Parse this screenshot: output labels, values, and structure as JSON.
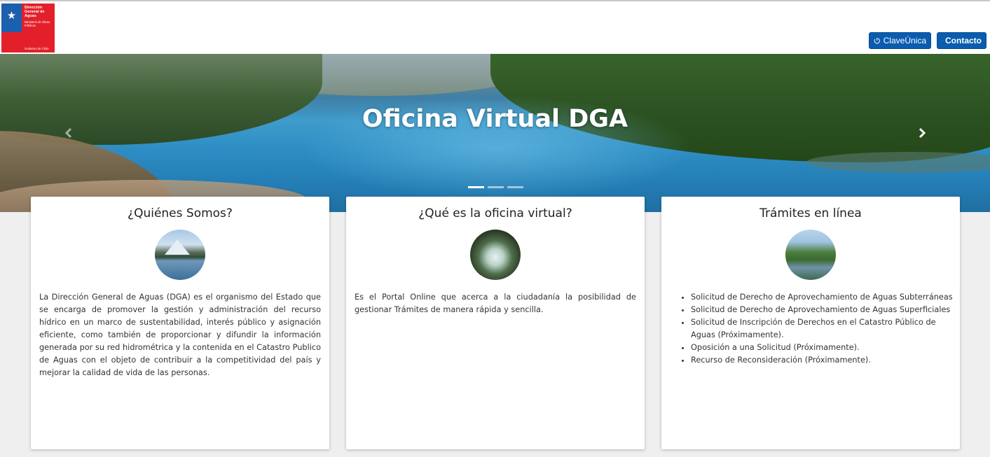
{
  "header": {
    "logo": {
      "line1": "Dirección General de Aguas",
      "line2": "Ministerio de Obras Públicas",
      "line3": "Gobierno de Chile"
    },
    "buttons": {
      "claveunica": "ClaveÚnica",
      "contacto": "Contacto"
    }
  },
  "hero": {
    "title": "Oficina Virtual DGA",
    "slides": 3,
    "active_slide": 1
  },
  "cards": {
    "quienes": {
      "title": "¿Quiénes Somos?",
      "text": "La Dirección General de Aguas (DGA) es el organismo del Estado que se encarga de promover la gestión y administración del recurso hídrico en un marco de sustentabilidad, interés público y asignación eficiente, como también de proporcionar y difundir la información generada por su red hidrométrica y la contenida en el Catastro Publico de Aguas con el objeto de contribuir a la competitividad del país y mejorar la calidad de vida de las personas."
    },
    "oficina": {
      "title": "¿Qué es la oficina virtual?",
      "text": "Es el Portal Online que acerca a la ciudadanía la posibilidad de gestionar Trámites de manera rápida y sencilla."
    },
    "tramites": {
      "title": "Trámites en línea",
      "items": [
        "Solicitud de Derecho de Aprovechamiento de Aguas Subterráneas",
        "Solicitud de Derecho de Aprovechamiento de Aguas Superficiales",
        "Solicitud de Inscripción de Derechos en el Catastro Público de Aguas (Próximamente).",
        "Oposición a una Solicitud (Próximamente).",
        "Recurso de Reconsideración (Próximamente)."
      ]
    }
  },
  "colors": {
    "primary_button": "#0a5caf",
    "flag_blue": "#1b5fae",
    "flag_red": "#e3202a",
    "page_bg": "#efefef"
  },
  "icons": {
    "claveunica": "power-icon",
    "contacto": "phone-icon",
    "carousel_prev": "chevron-left-icon",
    "carousel_next": "chevron-right-icon"
  }
}
